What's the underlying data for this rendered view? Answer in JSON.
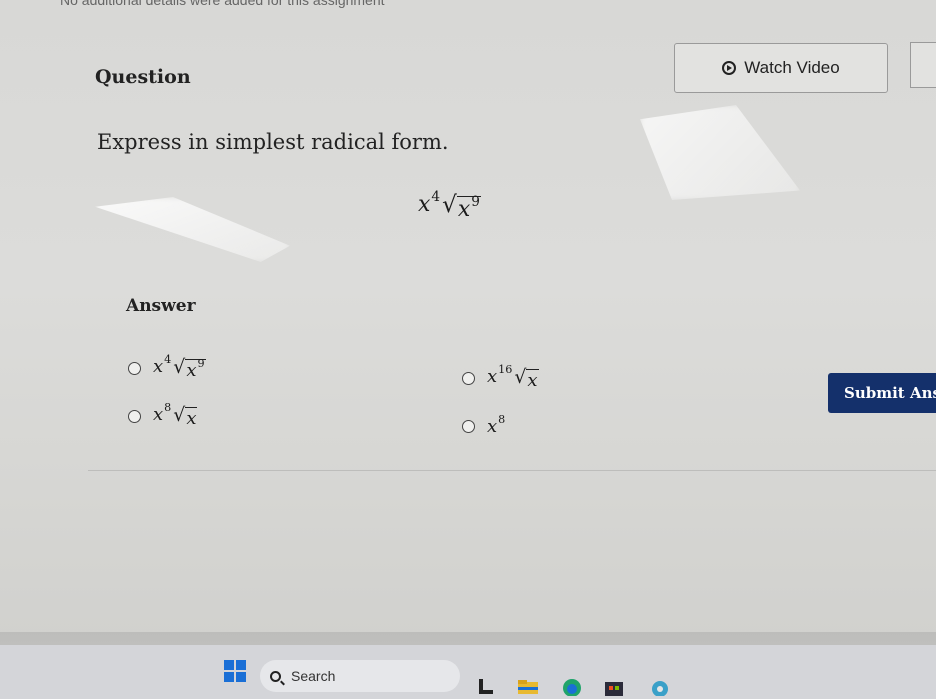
{
  "top_note": "No additional details were added for this assignment",
  "question": {
    "label": "Question",
    "prompt": "Express in simplest radical form."
  },
  "watch_video": {
    "label": "Watch Video",
    "icon": "play-circle-icon"
  },
  "expression": {
    "coef_base": "x",
    "coef_exp": "4",
    "radicand_base": "x",
    "radicand_exp": "9"
  },
  "answer": {
    "label": "Answer",
    "options": [
      {
        "coef_base": "x",
        "coef_exp": "4",
        "radicand_base": "x",
        "radicand_exp": "9"
      },
      {
        "coef_base": "x",
        "coef_exp": "16",
        "radicand_base": "x",
        "radicand_exp": ""
      },
      {
        "coef_base": "x",
        "coef_exp": "8",
        "radicand_base": "x",
        "radicand_exp": ""
      },
      {
        "coef_base": "x",
        "coef_exp": "8"
      }
    ]
  },
  "submit": {
    "label": "Submit Answer"
  },
  "taskbar": {
    "search_label": "Search"
  },
  "colors": {
    "submit_bg": "#14306b",
    "windows_blue": "#1a6fd6"
  }
}
